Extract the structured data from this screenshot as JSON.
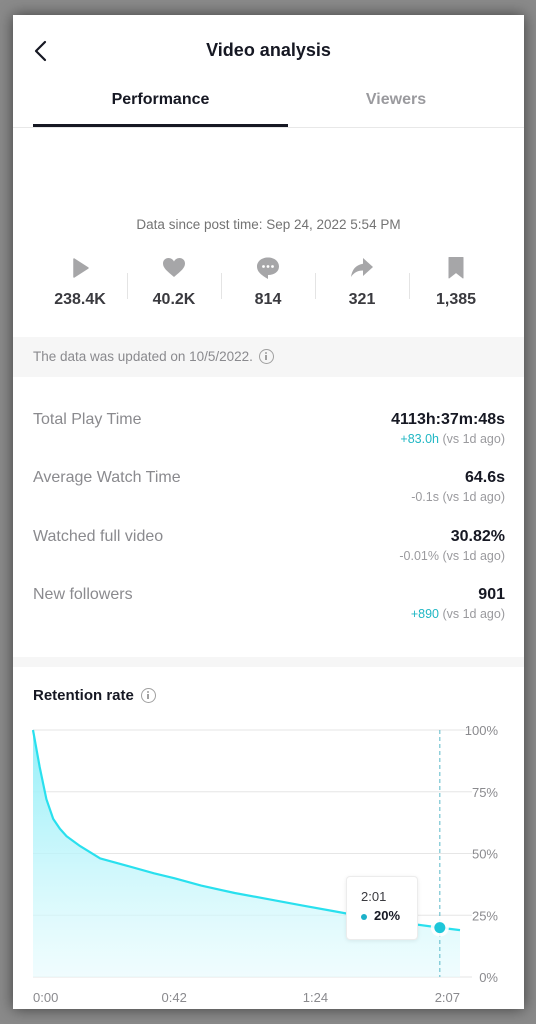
{
  "header": {
    "title": "Video analysis",
    "back_icon": "chevron-left-icon"
  },
  "tabs": [
    {
      "label": "Performance",
      "active": true
    },
    {
      "label": "Viewers",
      "active": false
    }
  ],
  "since_text": "Data since post time: Sep 24, 2022 5:54 PM",
  "stats": [
    {
      "icon": "play-icon",
      "value": "238.4K"
    },
    {
      "icon": "heart-icon",
      "value": "40.2K"
    },
    {
      "icon": "comment-icon",
      "value": "814"
    },
    {
      "icon": "share-icon",
      "value": "321"
    },
    {
      "icon": "bookmark-icon",
      "value": "1,385"
    }
  ],
  "updated_text": "The data was updated on 10/5/2022.",
  "metrics": [
    {
      "label": "Total Play Time",
      "value": "4113h:37m:48s",
      "delta": "+83.0h",
      "delta_suffix": " (vs 1d ago)",
      "delta_positive": true
    },
    {
      "label": "Average Watch Time",
      "value": "64.6s",
      "delta": "-0.1s",
      "delta_suffix": " (vs 1d ago)",
      "delta_positive": false
    },
    {
      "label": "Watched full video",
      "value": "30.82%",
      "delta": "-0.01%",
      "delta_suffix": " (vs 1d ago)",
      "delta_positive": false
    },
    {
      "label": "New followers",
      "value": "901",
      "delta": "+890",
      "delta_suffix": " (vs 1d ago)",
      "delta_positive": true
    }
  ],
  "colors": {
    "accent": "#20b7c4",
    "line": "#29e0ee",
    "fill": "#9ef0f8",
    "text": "#161823",
    "muted": "#8a8a8e"
  },
  "retention": {
    "title": "Retention rate",
    "tooltip": {
      "time": "2:01",
      "value": "20%"
    }
  },
  "chart_data": {
    "type": "area",
    "title": "Retention rate",
    "xlabel": "",
    "ylabel": "",
    "x_unit": "seconds",
    "xlim": [
      0,
      127
    ],
    "ylim": [
      0,
      100
    ],
    "x_tick_labels": [
      "0:00",
      "0:42",
      "1:24",
      "2:07"
    ],
    "x_tick_values": [
      0,
      42,
      84,
      127
    ],
    "y_tick_labels": [
      "100%",
      "75%",
      "50%",
      "25%",
      "0%"
    ],
    "y_tick_values": [
      100,
      75,
      50,
      25,
      0
    ],
    "grid": true,
    "series": [
      {
        "name": "Retention",
        "x": [
          0,
          2,
          4,
          6,
          8,
          10,
          14,
          20,
          28,
          36,
          42,
          50,
          60,
          70,
          80,
          90,
          100,
          110,
          121,
          127
        ],
        "values": [
          100,
          85,
          72,
          64,
          60,
          57,
          53,
          48,
          45,
          42,
          40,
          37,
          34,
          31.5,
          29,
          26.5,
          24,
          22,
          20,
          19
        ]
      }
    ],
    "highlight": {
      "x": 121,
      "label": "2:01",
      "value": 20
    }
  }
}
